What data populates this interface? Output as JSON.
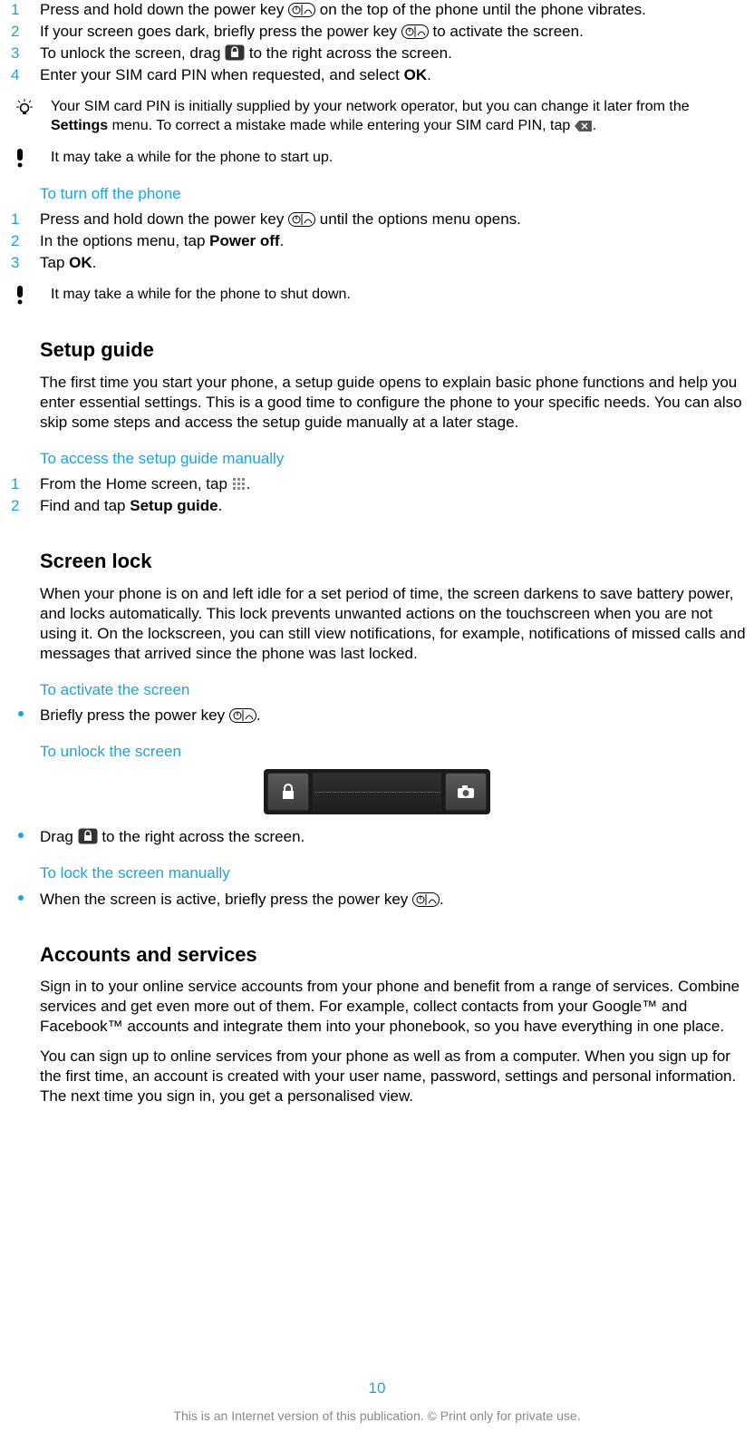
{
  "startup_steps": {
    "s1a": "Press and hold down the power key ",
    "s1b": " on the top of the phone until the phone vibrates.",
    "s2a": "If your screen goes dark, briefly press the power key ",
    "s2b": " to activate the screen.",
    "s3a": "To unlock the screen, drag ",
    "s3b": " to the right across the screen.",
    "s4a": "Enter your SIM card PIN when requested, and select ",
    "s4_ok": "OK",
    "s4c": "."
  },
  "tip1a": "Your SIM card PIN is initially supplied by your network operator, but you can change it later from the ",
  "tip1_settings": "Settings",
  "tip1b": " menu. To correct a mistake made while entering your SIM card PIN, tap ",
  "tip1c": ".",
  "warn1": "It may take a while for the phone to start up.",
  "h_turnoff": "To turn off the phone",
  "off": {
    "s1a": "Press and hold down the power key ",
    "s1b": " until the options menu opens.",
    "s2a": "In the options menu, tap ",
    "s2_po": "Power off",
    "s2b": ".",
    "s3a": "Tap ",
    "s3_ok": "OK",
    "s3b": "."
  },
  "warn2": "It may take a while for the phone to shut down.",
  "h_setup": "Setup guide",
  "p_setup": "The first time you start your phone, a setup guide opens to explain basic phone functions and help you enter essential settings. This is a good time to configure the phone to your specific needs. You can also skip some steps and access the setup guide manually at a later stage.",
  "h_setup_access": "To access the setup guide manually",
  "setup_steps": {
    "s1a": "From the Home screen, tap ",
    "s1b": ".",
    "s2a": "Find and tap ",
    "s2_setup": "Setup guide",
    "s2b": "."
  },
  "h_screenlock": "Screen lock",
  "p_screenlock": "When your phone is on and left idle for a set period of time, the screen darkens to save battery power, and locks automatically. This lock prevents unwanted actions on the touchscreen when you are not using it. On the lockscreen, you can still view notifications, for example, notifications of missed calls and messages that arrived since the phone was last locked.",
  "h_activate": "To activate the screen",
  "activate_a": "Briefly press the power key ",
  "activate_b": ".",
  "h_unlock": "To unlock the screen",
  "unlock_a": "Drag ",
  "unlock_b": " to the right across the screen.",
  "h_lockman": "To lock the screen manually",
  "lockman_a": "When the screen is active, briefly press the power key ",
  "lockman_b": ".",
  "h_accounts": "Accounts and services",
  "p_acc1": "Sign in to your online service accounts from your phone and benefit from a range of services. Combine services and get even more out of them. For example, collect contacts from your Google™ and Facebook™ accounts and integrate them into your phonebook, so you have everything in one place.",
  "p_acc2": "You can sign up to online services from your phone as well as from a computer. When you sign up for the first time, an account is created with your user name, password, settings and personal information. The next time you sign in, you get a personalised view.",
  "page_number": "10",
  "footer": "This is an Internet version of this publication. © Print only for private use."
}
